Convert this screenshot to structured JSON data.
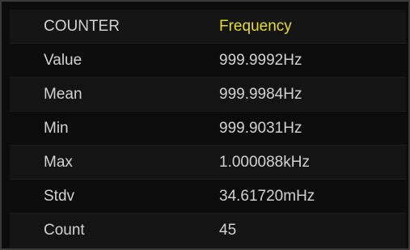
{
  "counter": {
    "header": {
      "label": "COUNTER",
      "mode": "Frequency",
      "mode_color": "#e6dd2a"
    },
    "rows": [
      {
        "label": "Value",
        "value": "999.9992Hz"
      },
      {
        "label": "Mean",
        "value": "999.9984Hz"
      },
      {
        "label": "Min",
        "value": "999.9031Hz"
      },
      {
        "label": "Max",
        "value": "1.000088kHz"
      },
      {
        "label": "Stdv",
        "value": "34.61720mHz"
      },
      {
        "label": "Count",
        "value": "45"
      }
    ]
  }
}
